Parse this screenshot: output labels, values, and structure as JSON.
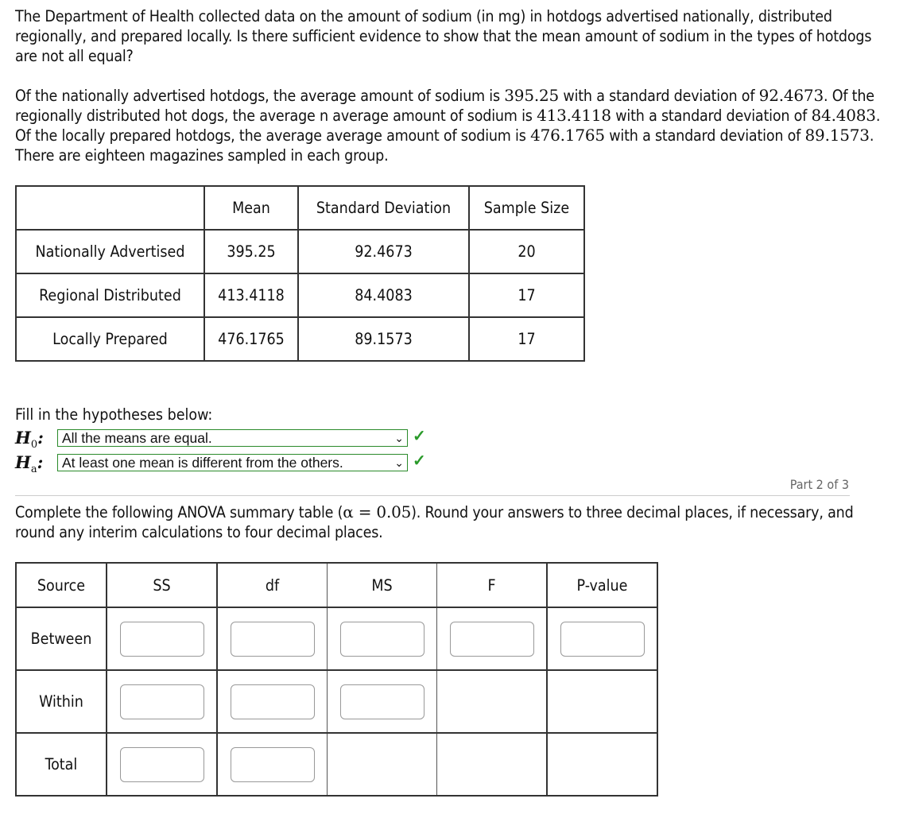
{
  "intro": "The Department of Health collected data on the amount of sodium (in mg) in hotdogs advertised nationally, distributed regionally, and prepared locally. Is there sufficient evidence to show that the mean amount of sodium in the types of hotdogs are not all equal?",
  "details": {
    "t1": "Of the nationally advertised hotdogs, the average amount of sodium is ",
    "n1": "395.25",
    "t2": " with a standard deviation of ",
    "n2": "92.4673",
    "t3": ". Of the regionally distributed hot dogs, the average n average amount of sodium is ",
    "n3": "413.4118",
    "t4": " with a standard deviation of ",
    "n4": "84.4083",
    "t5": ". Of the locally prepared hotdogs, the average average amount of sodium is ",
    "n5": "476.1765",
    "t6": " with a standard deviation of ",
    "n6": "89.1573",
    "t7": ". There are eighteen magazines sampled in each group."
  },
  "stats_table": {
    "headers": [
      "",
      "Mean",
      "Standard Deviation",
      "Sample Size"
    ],
    "rows": [
      [
        "Nationally Advertised",
        "395.25",
        "92.4673",
        "20"
      ],
      [
        "Regional Distributed",
        "413.4118",
        "84.4083",
        "17"
      ],
      [
        "Locally Prepared",
        "476.1765",
        "89.1573",
        "17"
      ]
    ]
  },
  "hypotheses": {
    "prompt": "Fill in the hypotheses below:",
    "h0_label": "H",
    "h0_sub": "0",
    "h0_value": "All the means are equal.",
    "ha_label": "H",
    "ha_sub": "a",
    "ha_value": "At least one mean is different from the others.",
    "status_color": "#2a9a2a"
  },
  "part": "Part 2 of 3",
  "anova_prompt": {
    "t1": "Complete the following ANOVA summary table (",
    "alpha": "α = 0.05",
    "t2": "). Round your answers to three decimal places, if necessary, and round any interim calculations to four decimal places."
  },
  "anova_table": {
    "headers": [
      "Source",
      "SS",
      "df",
      "MS",
      "F",
      "P-value"
    ],
    "rows": [
      "Between",
      "Within",
      "Total"
    ]
  }
}
